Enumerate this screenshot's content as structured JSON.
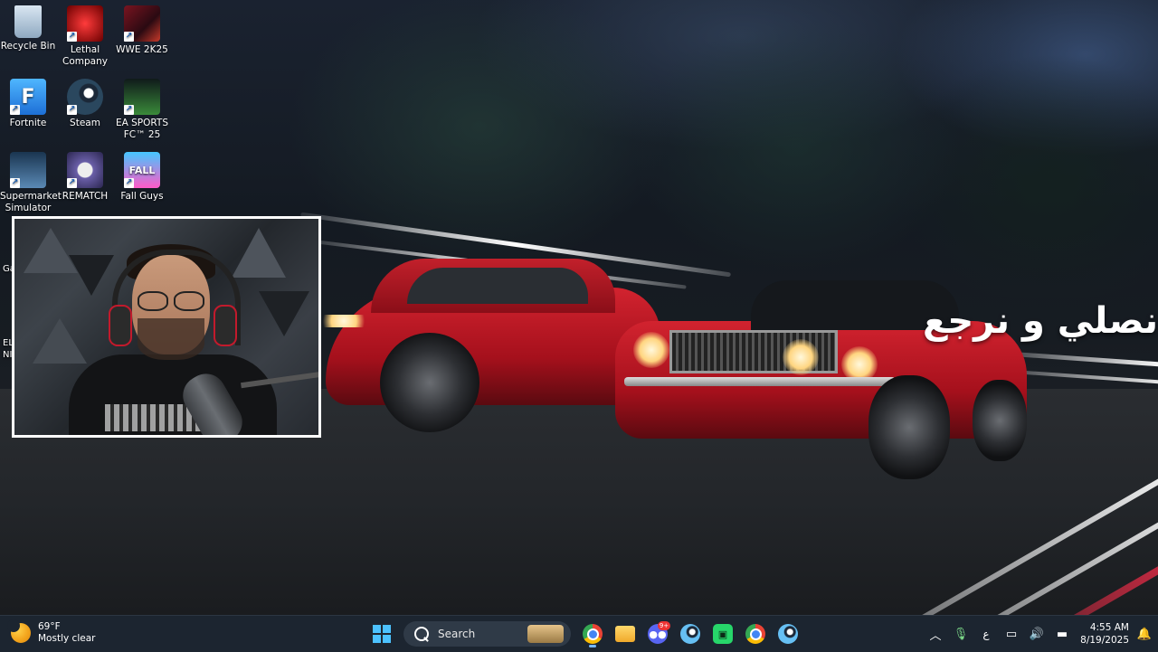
{
  "desktop": {
    "icons": [
      {
        "label": "Recycle Bin",
        "icon": "recycle-bin-icon"
      },
      {
        "label": "Lethal Company",
        "icon": "lethal-company-icon"
      },
      {
        "label": "WWE 2K25",
        "icon": "wwe-icon"
      },
      {
        "label": "Fortnite",
        "icon": "fortnite-icon",
        "glyph": "F"
      },
      {
        "label": "Steam",
        "icon": "steam-icon"
      },
      {
        "label": "EA SPORTS FC™ 25",
        "icon": "fc25-icon"
      },
      {
        "label": "Supermarket Simulator",
        "icon": "supermarket-icon"
      },
      {
        "label": "REMATCH",
        "icon": "rematch-icon"
      },
      {
        "label": "Fall Guys",
        "icon": "fall-guys-icon",
        "glyph": "FALL"
      }
    ],
    "partial_labels": [
      "Ga",
      "EL",
      "NI"
    ]
  },
  "wallpaper": {
    "overlay_text": "نصلي و نرجع"
  },
  "taskbar": {
    "weather": {
      "temp": "69°F",
      "condition": "Mostly clear"
    },
    "search_label": "Search",
    "apps": [
      {
        "name": "chrome",
        "icon": "chrome-icon",
        "active": true
      },
      {
        "name": "file-explorer",
        "icon": "folder-icon",
        "active": false
      },
      {
        "name": "discord",
        "icon": "discord-icon",
        "badge": "9+",
        "active": false
      },
      {
        "name": "steam",
        "icon": "steam-icon",
        "active": false
      },
      {
        "name": "streaming-app",
        "icon": "green-app-icon",
        "active": false
      },
      {
        "name": "chrome-alt",
        "icon": "chrome-icon",
        "active": false
      },
      {
        "name": "steam-alt",
        "icon": "steam-icon",
        "active": false
      }
    ],
    "tray": {
      "language": "ع",
      "time": "4:55 AM",
      "date": "8/19/2025"
    }
  }
}
